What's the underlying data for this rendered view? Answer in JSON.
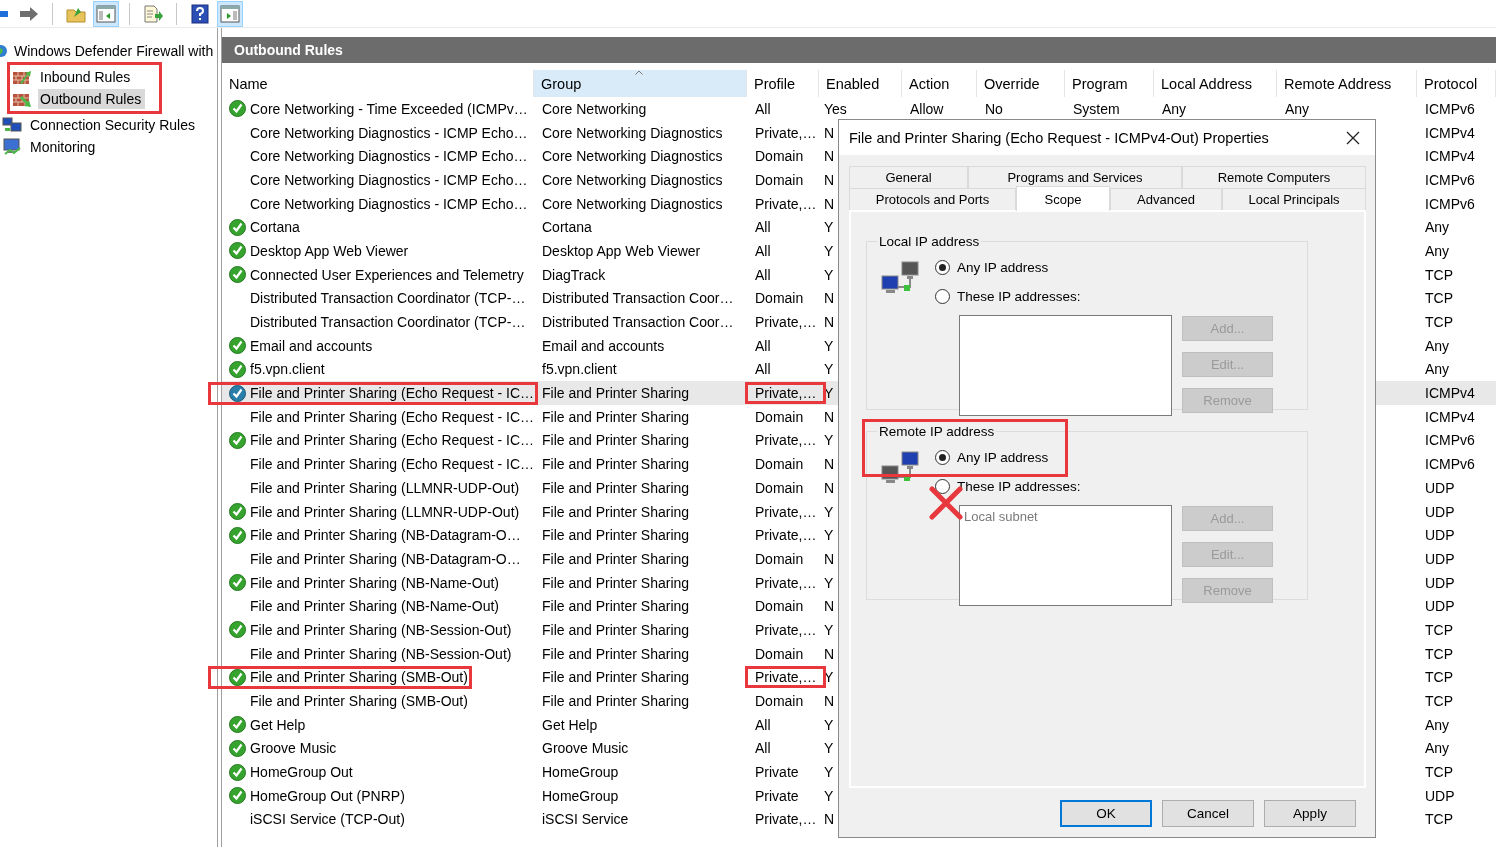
{
  "toolbar": [
    {
      "kind": "back",
      "pressed": false
    },
    {
      "kind": "forward",
      "pressed": false
    },
    {
      "kind": "separator"
    },
    {
      "kind": "up",
      "pressed": false
    },
    {
      "kind": "tree-toggle",
      "pressed": true
    },
    {
      "kind": "separator"
    },
    {
      "kind": "export",
      "pressed": false
    },
    {
      "kind": "separator"
    },
    {
      "kind": "help",
      "pressed": false
    },
    {
      "kind": "action-toggle",
      "pressed": true
    }
  ],
  "tree": {
    "root": "Windows Defender Firewall with",
    "items": [
      {
        "label": "Inbound Rules",
        "kind": "inbound",
        "selected": false,
        "highlighted": true
      },
      {
        "label": "Outbound Rules",
        "kind": "outbound",
        "selected": true,
        "highlighted": true
      },
      {
        "label": "Connection Security Rules",
        "kind": "security",
        "selected": false,
        "highlighted": false
      },
      {
        "label": "Monitoring",
        "kind": "monitoring",
        "selected": false,
        "highlighted": false
      }
    ]
  },
  "pane_title": "Outbound Rules",
  "table": {
    "columns": [
      {
        "label": "Name",
        "sorted": false
      },
      {
        "label": "Group",
        "sorted": true
      },
      {
        "label": "Profile",
        "sorted": false
      },
      {
        "label": "Enabled",
        "sorted": false
      },
      {
        "label": "Action",
        "sorted": false
      },
      {
        "label": "Override",
        "sorted": false
      },
      {
        "label": "Program",
        "sorted": false
      },
      {
        "label": "Local Address",
        "sorted": false
      },
      {
        "label": "Remote Address",
        "sorted": false
      },
      {
        "label": "Protocol",
        "sorted": false
      }
    ],
    "rows": [
      {
        "name": "Core Networking - Time Exceeded (ICMPv…",
        "group": "Core Networking",
        "profile": "All",
        "enabled": "Yes",
        "action": "Allow",
        "override": "No",
        "program": "System",
        "local_address": "Any",
        "remote_address": "Any",
        "protocol": "ICMPv6",
        "active": true,
        "selected": false,
        "marked": false
      },
      {
        "name": "Core Networking Diagnostics - ICMP Echo…",
        "group": "Core Networking Diagnostics",
        "profile": "Private,…",
        "enabled": "N",
        "protocol": "ICMPv4",
        "active": false,
        "selected": false,
        "marked": false
      },
      {
        "name": "Core Networking Diagnostics - ICMP Echo…",
        "group": "Core Networking Diagnostics",
        "profile": "Domain",
        "enabled": "N",
        "protocol": "ICMPv4",
        "active": false,
        "selected": false,
        "marked": false
      },
      {
        "name": "Core Networking Diagnostics - ICMP Echo…",
        "group": "Core Networking Diagnostics",
        "profile": "Domain",
        "enabled": "N",
        "protocol": "ICMPv6",
        "active": false,
        "selected": false,
        "marked": false
      },
      {
        "name": "Core Networking Diagnostics - ICMP Echo…",
        "group": "Core Networking Diagnostics",
        "profile": "Private,…",
        "enabled": "N",
        "protocol": "ICMPv6",
        "active": false,
        "selected": false,
        "marked": false
      },
      {
        "name": "Cortana",
        "group": "Cortana",
        "profile": "All",
        "enabled": "Y",
        "protocol": "Any",
        "active": true,
        "selected": false,
        "marked": false
      },
      {
        "name": "Desktop App Web Viewer",
        "group": "Desktop App Web Viewer",
        "profile": "All",
        "enabled": "Y",
        "protocol": "Any",
        "active": true,
        "selected": false,
        "marked": false
      },
      {
        "name": "Connected User Experiences and Telemetry",
        "group": "DiagTrack",
        "profile": "All",
        "enabled": "Y",
        "protocol": "TCP",
        "active": true,
        "selected": false,
        "marked": false
      },
      {
        "name": "Distributed Transaction Coordinator (TCP-…",
        "group": "Distributed Transaction Coor…",
        "profile": "Domain",
        "enabled": "N",
        "protocol": "TCP",
        "active": false,
        "selected": false,
        "marked": false
      },
      {
        "name": "Distributed Transaction Coordinator (TCP-…",
        "group": "Distributed Transaction Coor…",
        "profile": "Private,…",
        "enabled": "N",
        "protocol": "TCP",
        "active": false,
        "selected": false,
        "marked": false
      },
      {
        "name": "Email and accounts",
        "group": "Email and accounts",
        "profile": "All",
        "enabled": "Y",
        "protocol": "Any",
        "active": true,
        "selected": false,
        "marked": false
      },
      {
        "name": "f5.vpn.client",
        "group": "f5.vpn.client",
        "profile": "All",
        "enabled": "Y",
        "protocol": "Any",
        "active": true,
        "selected": false,
        "marked": false
      },
      {
        "name": "File and Printer Sharing (Echo Request - IC…",
        "group": "File and Printer Sharing",
        "profile": "Private,…",
        "enabled": "Y",
        "protocol": "ICMPv4",
        "active": true,
        "selected": true,
        "marked": true
      },
      {
        "name": "File and Printer Sharing (Echo Request - IC…",
        "group": "File and Printer Sharing",
        "profile": "Domain",
        "enabled": "N",
        "protocol": "ICMPv4",
        "active": false,
        "selected": false,
        "marked": false
      },
      {
        "name": "File and Printer Sharing (Echo Request - IC…",
        "group": "File and Printer Sharing",
        "profile": "Private,…",
        "enabled": "Y",
        "protocol": "ICMPv6",
        "active": true,
        "selected": false,
        "marked": false
      },
      {
        "name": "File and Printer Sharing (Echo Request - IC…",
        "group": "File and Printer Sharing",
        "profile": "Domain",
        "enabled": "N",
        "protocol": "ICMPv6",
        "active": false,
        "selected": false,
        "marked": false
      },
      {
        "name": "File and Printer Sharing (LLMNR-UDP-Out)",
        "group": "File and Printer Sharing",
        "profile": "Domain",
        "enabled": "N",
        "protocol": "UDP",
        "active": false,
        "selected": false,
        "marked": false
      },
      {
        "name": "File and Printer Sharing (LLMNR-UDP-Out)",
        "group": "File and Printer Sharing",
        "profile": "Private,…",
        "enabled": "Y",
        "protocol": "UDP",
        "active": true,
        "selected": false,
        "marked": false
      },
      {
        "name": "File and Printer Sharing (NB-Datagram-O…",
        "group": "File and Printer Sharing",
        "profile": "Private,…",
        "enabled": "Y",
        "protocol": "UDP",
        "active": true,
        "selected": false,
        "marked": false
      },
      {
        "name": "File and Printer Sharing (NB-Datagram-O…",
        "group": "File and Printer Sharing",
        "profile": "Domain",
        "enabled": "N",
        "protocol": "UDP",
        "active": false,
        "selected": false,
        "marked": false
      },
      {
        "name": "File and Printer Sharing (NB-Name-Out)",
        "group": "File and Printer Sharing",
        "profile": "Private,…",
        "enabled": "Y",
        "protocol": "UDP",
        "active": true,
        "selected": false,
        "marked": false
      },
      {
        "name": "File and Printer Sharing (NB-Name-Out)",
        "group": "File and Printer Sharing",
        "profile": "Domain",
        "enabled": "N",
        "protocol": "UDP",
        "active": false,
        "selected": false,
        "marked": false
      },
      {
        "name": "File and Printer Sharing (NB-Session-Out)",
        "group": "File and Printer Sharing",
        "profile": "Private,…",
        "enabled": "Y",
        "protocol": "TCP",
        "active": true,
        "selected": false,
        "marked": false
      },
      {
        "name": "File and Printer Sharing (NB-Session-Out)",
        "group": "File and Printer Sharing",
        "profile": "Domain",
        "enabled": "N",
        "protocol": "TCP",
        "active": false,
        "selected": false,
        "marked": false
      },
      {
        "name": "File and Printer Sharing (SMB-Out)",
        "group": "File and Printer Sharing",
        "profile": "Private,…",
        "enabled": "Y",
        "protocol": "TCP",
        "active": true,
        "selected": false,
        "marked": true
      },
      {
        "name": "File and Printer Sharing (SMB-Out)",
        "group": "File and Printer Sharing",
        "profile": "Domain",
        "enabled": "N",
        "protocol": "TCP",
        "active": false,
        "selected": false,
        "marked": false
      },
      {
        "name": "Get Help",
        "group": "Get Help",
        "profile": "All",
        "enabled": "Y",
        "protocol": "Any",
        "active": true,
        "selected": false,
        "marked": false
      },
      {
        "name": "Groove Music",
        "group": "Groove Music",
        "profile": "All",
        "enabled": "Y",
        "protocol": "Any",
        "active": true,
        "selected": false,
        "marked": false
      },
      {
        "name": "HomeGroup Out",
        "group": "HomeGroup",
        "profile": "Private",
        "enabled": "Y",
        "protocol": "TCP",
        "active": true,
        "selected": false,
        "marked": false
      },
      {
        "name": "HomeGroup Out (PNRP)",
        "group": "HomeGroup",
        "profile": "Private",
        "enabled": "Y",
        "protocol": "UDP",
        "active": true,
        "selected": false,
        "marked": false
      },
      {
        "name": "iSCSI Service (TCP-Out)",
        "group": "iSCSI Service",
        "profile": "Private,…",
        "enabled": "N",
        "protocol": "TCP",
        "active": false,
        "selected": false,
        "marked": false
      }
    ]
  },
  "dialog": {
    "title": "File and Printer Sharing (Echo Request - ICMPv4-Out) Properties",
    "tab_rows": [
      [
        {
          "label": "General",
          "selected": false
        },
        {
          "label": "Programs and Services",
          "selected": false
        },
        {
          "label": "Remote Computers",
          "selected": false
        }
      ],
      [
        {
          "label": "Protocols and Ports",
          "selected": false
        },
        {
          "label": "Scope",
          "selected": true
        },
        {
          "label": "Advanced",
          "selected": false
        },
        {
          "label": "Local Principals",
          "selected": false
        }
      ]
    ],
    "groups": [
      {
        "label": "Local IP address",
        "kind": "local",
        "marked": false,
        "options": [
          {
            "label": "Any IP address",
            "selected": true,
            "crossed": false
          },
          {
            "label": "These IP addresses:",
            "selected": false,
            "crossed": false
          }
        ],
        "buttons": [
          {
            "label": "Add...",
            "disabled": true
          },
          {
            "label": "Edit...",
            "disabled": true
          },
          {
            "label": "Remove",
            "disabled": true
          }
        ]
      },
      {
        "label": "Remote IP address",
        "kind": "remote",
        "marked": true,
        "options": [
          {
            "label": "Any IP address",
            "selected": true,
            "crossed": false
          },
          {
            "label": "These IP addresses:",
            "selected": false,
            "crossed": true
          }
        ],
        "list": [
          "Local subnet"
        ],
        "buttons": [
          {
            "label": "Add...",
            "disabled": true
          },
          {
            "label": "Edit...",
            "disabled": true
          },
          {
            "label": "Remove",
            "disabled": true
          }
        ]
      }
    ],
    "buttons": [
      {
        "label": "OK",
        "default": true
      },
      {
        "label": "Cancel",
        "default": false
      },
      {
        "label": "Apply",
        "default": false
      }
    ]
  }
}
